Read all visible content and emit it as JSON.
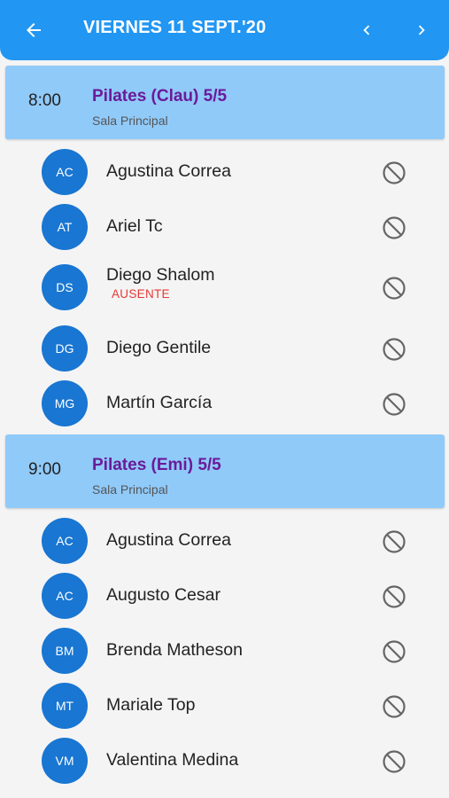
{
  "appbar": {
    "title": "VIERNES 11 SEPT.'20",
    "back_icon": "arrow-back-icon",
    "prev_icon": "chevron-left-icon",
    "next_icon": "chevron-right-icon"
  },
  "colors": {
    "appbar": "#2196f3",
    "session_header": "#90caf9",
    "session_title": "#6a1b9a",
    "avatar": "#1976d2",
    "status_absent": "#e53935"
  },
  "sessions": [
    {
      "time": "8:00",
      "title": "Pilates (Clau) 5/5",
      "room": "Sala Principal",
      "attendees": [
        {
          "initials": "AC",
          "name": "Agustina Correa",
          "status": ""
        },
        {
          "initials": "AT",
          "name": "Ariel Tc",
          "status": ""
        },
        {
          "initials": "DS",
          "name": "Diego Shalom",
          "status": "AUSENTE"
        },
        {
          "initials": "DG",
          "name": "Diego Gentile",
          "status": ""
        },
        {
          "initials": "MG",
          "name": "Martín García",
          "status": ""
        }
      ]
    },
    {
      "time": "9:00",
      "title": "Pilates (Emi) 5/5",
      "room": "Sala Principal",
      "attendees": [
        {
          "initials": "AC",
          "name": "Agustina Correa",
          "status": ""
        },
        {
          "initials": "AC",
          "name": "Augusto Cesar",
          "status": ""
        },
        {
          "initials": "BM",
          "name": "Brenda Matheson",
          "status": ""
        },
        {
          "initials": "MT",
          "name": "Mariale Top",
          "status": ""
        },
        {
          "initials": "VM",
          "name": "Valentina Medina",
          "status": ""
        }
      ]
    }
  ]
}
